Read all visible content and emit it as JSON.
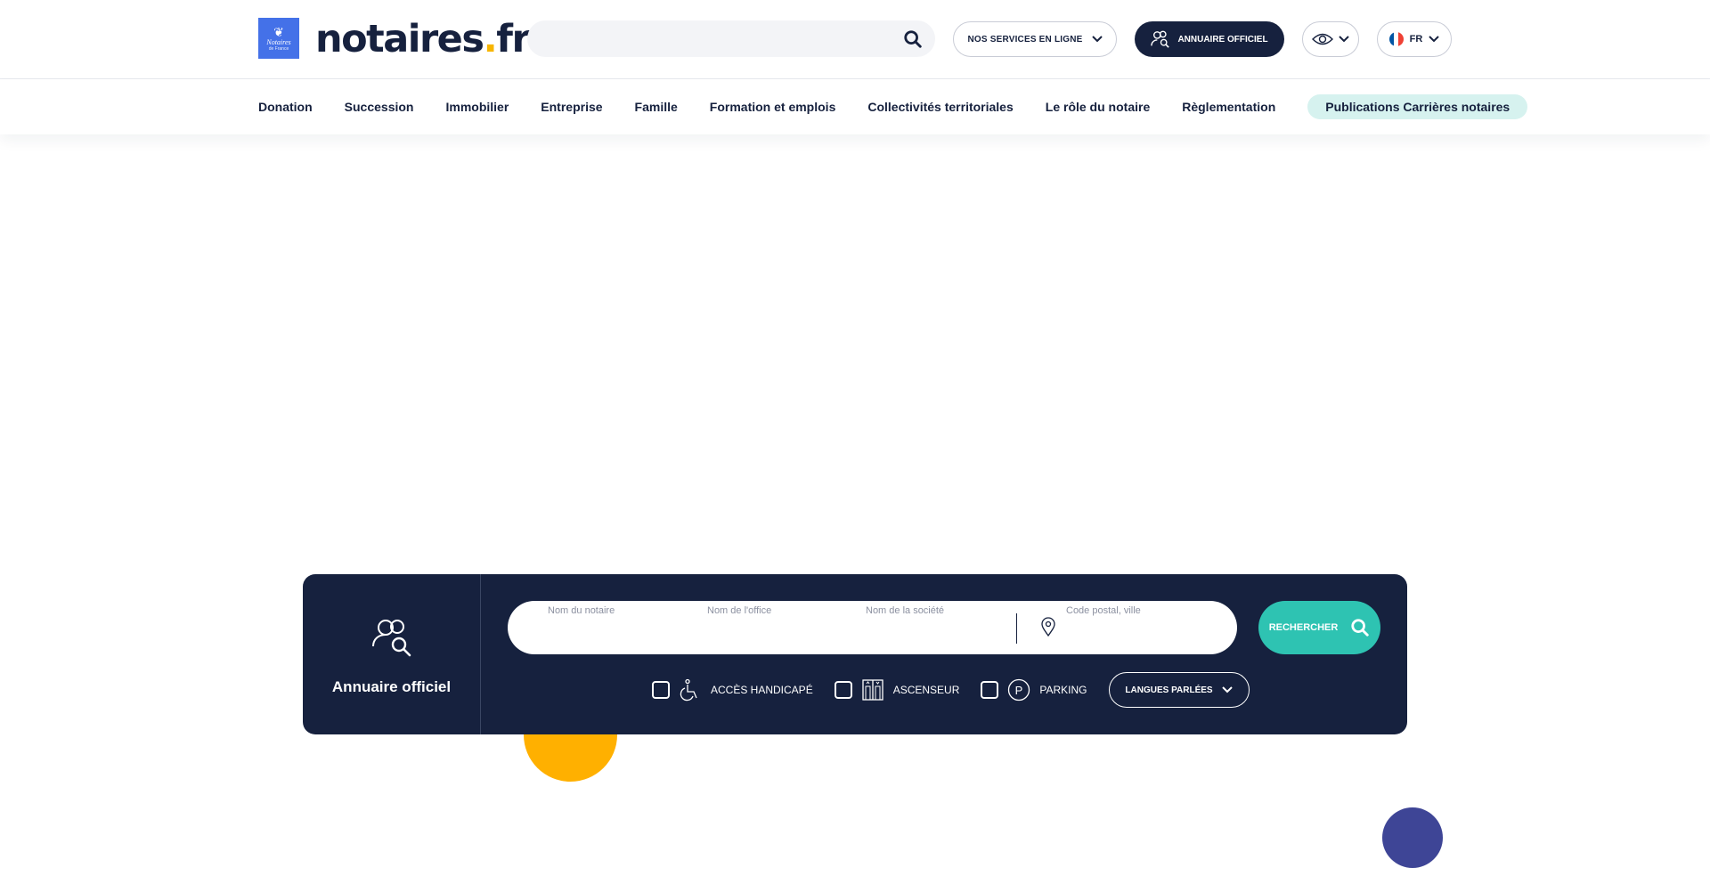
{
  "brand": {
    "badge_line1": "Notaires",
    "badge_line2": "de France",
    "name_part1": "notaires",
    "name_dot": ".",
    "name_part2": "fr"
  },
  "header": {
    "search": {
      "placeholder": "",
      "icon": "search-icon"
    },
    "services_label": "NOS SERVICES EN LIGNE",
    "annuaire_label": "ANNUAIRE OFFICIEL",
    "accessibility_icon": "eye-icon",
    "language": {
      "code": "FR",
      "flag_colors": [
        "#0055a4",
        "#ffffff",
        "#ef4135"
      ]
    }
  },
  "nav": {
    "items": [
      {
        "label": "Donation"
      },
      {
        "label": "Succession"
      },
      {
        "label": "Immobilier"
      },
      {
        "label": "Entreprise"
      },
      {
        "label": "Famille"
      },
      {
        "label": "Formation et emplois"
      },
      {
        "label": "Collectivités territoriales"
      },
      {
        "label": "Le rôle du notaire"
      },
      {
        "label": "Règlementation"
      },
      {
        "label": "Publications Carrières notaires"
      }
    ]
  },
  "directory": {
    "title": "Annuaire officiel",
    "fields": {
      "notary_name": {
        "label": "Nom du notaire",
        "value": ""
      },
      "office_name": {
        "label": "Nom de l'office",
        "value": ""
      },
      "company_name": {
        "label": "Nom de la société",
        "value": ""
      },
      "location": {
        "label": "Code postal, ville",
        "value": ""
      }
    },
    "search_label": "RECHERCHER",
    "filters": {
      "accessibility": "ACCÈS HANDICAPÉ",
      "elevator": "ASCENSEUR",
      "parking": "PARKING",
      "parking_letter": "P",
      "languages": "LANGUES PARLÉES"
    }
  },
  "colors": {
    "navy": "#16213e",
    "accent_teal": "#2ec3b2",
    "logo_blue": "#4471e8",
    "yellow": "#ffb000",
    "nav_pill": "#d6f2ef",
    "decor_blue": "#3e4596"
  }
}
